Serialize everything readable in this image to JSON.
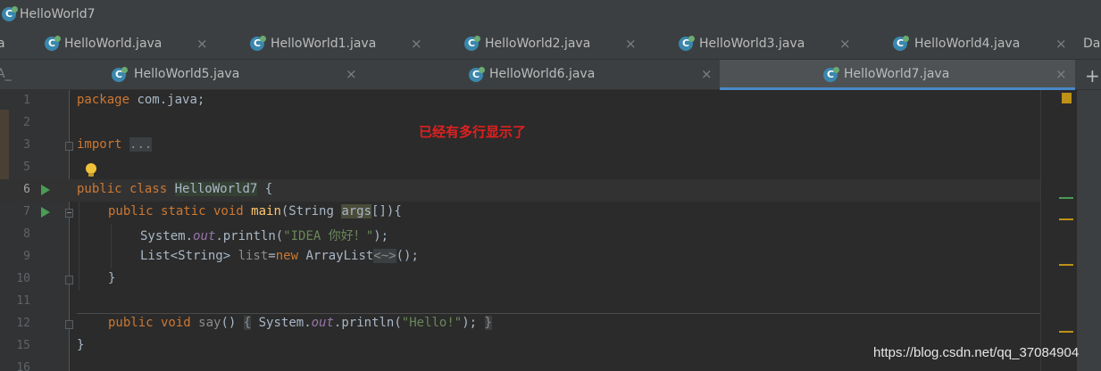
{
  "window": {
    "title": "HelloWorld7"
  },
  "tabs_row1": {
    "left_edge": "a",
    "right_edge": "Da",
    "tabs": [
      {
        "label": "HelloWorld.java",
        "close": "×"
      },
      {
        "label": "HelloWorld1.java",
        "close": "×"
      },
      {
        "label": "HelloWorld2.java",
        "close": "×"
      },
      {
        "label": "HelloWorld3.java",
        "close": "×"
      },
      {
        "label": "HelloWorld4.java",
        "close": "×"
      }
    ]
  },
  "tabs_row2": {
    "left_edge": "A_",
    "plus": "+",
    "tabs": [
      {
        "label": "HelloWorld5.java",
        "close": "×"
      },
      {
        "label": "HelloWorld6.java",
        "close": "×"
      },
      {
        "label": "HelloWorld7.java",
        "close": "×",
        "active": true
      }
    ]
  },
  "editor": {
    "line_numbers": [
      "1",
      "2",
      "3",
      "5",
      "6",
      "7",
      "8",
      "9",
      "10",
      "11",
      "12",
      "15",
      "16"
    ],
    "current_line": "6",
    "code": {
      "l1_kw": "package",
      "l1_rest": " com.java;",
      "l3_kw": "import",
      "l3_fold": "...",
      "l6_kw": "public class",
      "l6_class": "HelloWorld7",
      "l6_rest": " {",
      "l7_kw": "public static void",
      "l7_method": "main",
      "l7_a": "(String ",
      "l7_arg": "args",
      "l7_b": "[]){",
      "l8_a": "System.",
      "l8_field": "out",
      "l8_b": ".println(",
      "l8_str": "\"IDEA 你好！\"",
      "l8_c": ");",
      "l9_a": "List<String> ",
      "l9_var": "list",
      "l9_eq": "=",
      "l9_kw": "new",
      "l9_b": " ArrayList",
      "l9_diamond": "<~>",
      "l9_c": "();",
      "l10": "}",
      "l12_kw": "public void",
      "l12_method": "say",
      "l12_a": "() ",
      "l12_brace_open": "{",
      "l12_b": " System.",
      "l12_field": "out",
      "l12_c": ".println(",
      "l12_str": "\"Hello!\"",
      "l12_d": ");",
      "l12_brace_close": "}",
      "l15": "}"
    },
    "annotation": "已经有多行显示了",
    "watermark": "https://blog.csdn.net/qq_37084904"
  },
  "colors": {
    "keyword": "#cc7832",
    "string": "#6a8759",
    "field": "#9876aa",
    "default": "#a9b7c6",
    "annotation": "#e02020",
    "active_tab_underline": "#4a88c7"
  },
  "icons": {
    "tab_file": "java-class-icon",
    "gutter_run": "run-icon",
    "intention": "lightbulb-icon",
    "fold": "fold-icon"
  }
}
